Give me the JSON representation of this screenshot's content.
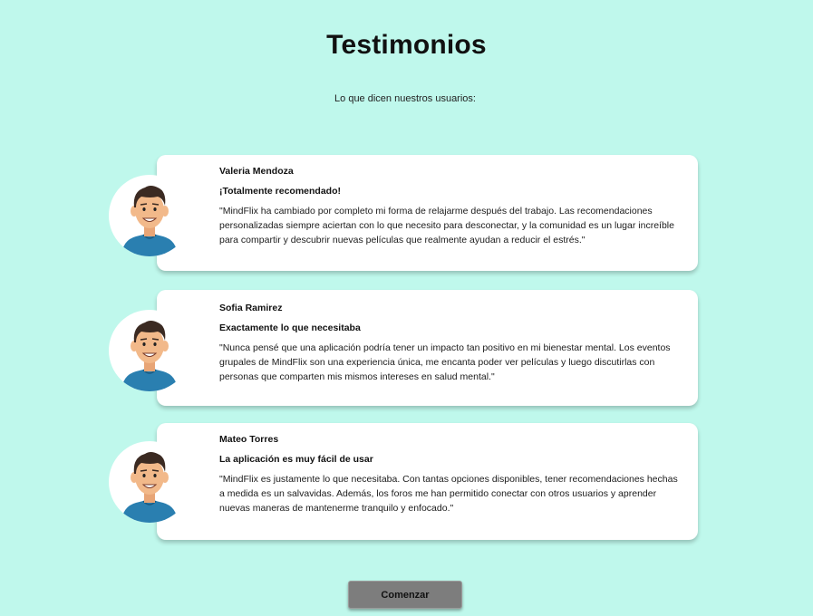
{
  "page": {
    "title": "Testimonios",
    "subtitle": "Lo que dicen nuestros usuarios:"
  },
  "testimonials": [
    {
      "name": "Valeria Mendoza",
      "headline": "¡Totalmente recomendado!",
      "quote": "\"MindFlix ha cambiado por completo mi forma de relajarme después del trabajo. Las recomendaciones personalizadas siempre aciertan con lo que necesito para desconectar, y la comunidad es un lugar increíble para compartir y descubrir nuevas películas que realmente ayudan a reducir el estrés.\"",
      "avatar_icon": "male-avatar-icon"
    },
    {
      "name": "Sofia Ramirez",
      "headline": "Exactamente lo que necesitaba",
      "quote": "\"Nunca pensé que una aplicación podría tener un impacto tan positivo en mi bienestar mental. Los eventos grupales de MindFlix son una experiencia única, me encanta poder ver películas y luego discutirlas con personas que comparten mis mismos intereses en salud mental.\"",
      "avatar_icon": "male-avatar-icon"
    },
    {
      "name": "Mateo Torres",
      "headline": "La aplicación es muy fácil de usar",
      "quote": "\"MindFlix es justamente lo que necesitaba. Con tantas opciones disponibles, tener recomendaciones hechas a medida es un salvavidas. Además, los foros me han permitido conectar con otros usuarios y aprender nuevas maneras de mantenerme tranquilo y enfocado.\"",
      "avatar_icon": "male-avatar-icon"
    }
  ],
  "actions": {
    "start_label": "Comenzar"
  },
  "colors": {
    "background": "#bff8ec",
    "card": "#ffffff",
    "button": "#7d7d7d",
    "shirt": "#2a7fb0",
    "skin": "#f2b98a",
    "hair": "#3b2a22"
  }
}
